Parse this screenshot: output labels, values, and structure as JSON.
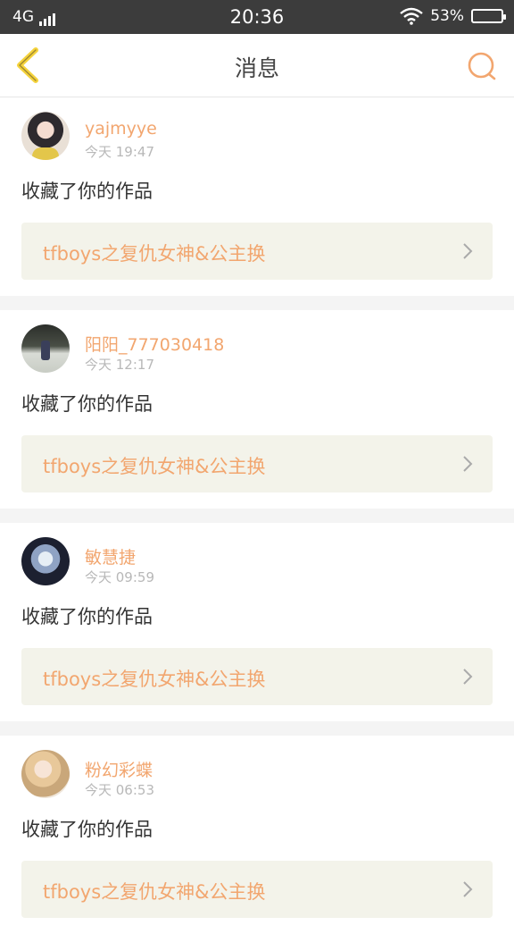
{
  "status_bar": {
    "network": "4G",
    "time": "20:36",
    "battery": "53%"
  },
  "header": {
    "title": "消息",
    "back_icon": "back-arrow-icon",
    "search_icon": "search-icon"
  },
  "colors": {
    "accent": "#f2a66f",
    "back_arrow": "#f5d33c",
    "card_bg": "#f3f3ea",
    "status_bar": "#3c3c3c"
  },
  "messages": [
    {
      "username": "yajmyye",
      "time": "今天 19:47",
      "action": "收藏了你的作品",
      "work_title": "tfboys之复仇女神&公主换"
    },
    {
      "username": "阳阳_777030418",
      "time": "今天 12:17",
      "action": "收藏了你的作品",
      "work_title": "tfboys之复仇女神&公主换"
    },
    {
      "username": "敏慧捷",
      "time": "今天 09:59",
      "action": "收藏了你的作品",
      "work_title": "tfboys之复仇女神&公主换"
    },
    {
      "username": "粉幻彩蝶",
      "time": "今天 06:53",
      "action": "收藏了你的作品",
      "work_title": "tfboys之复仇女神&公主换"
    }
  ]
}
